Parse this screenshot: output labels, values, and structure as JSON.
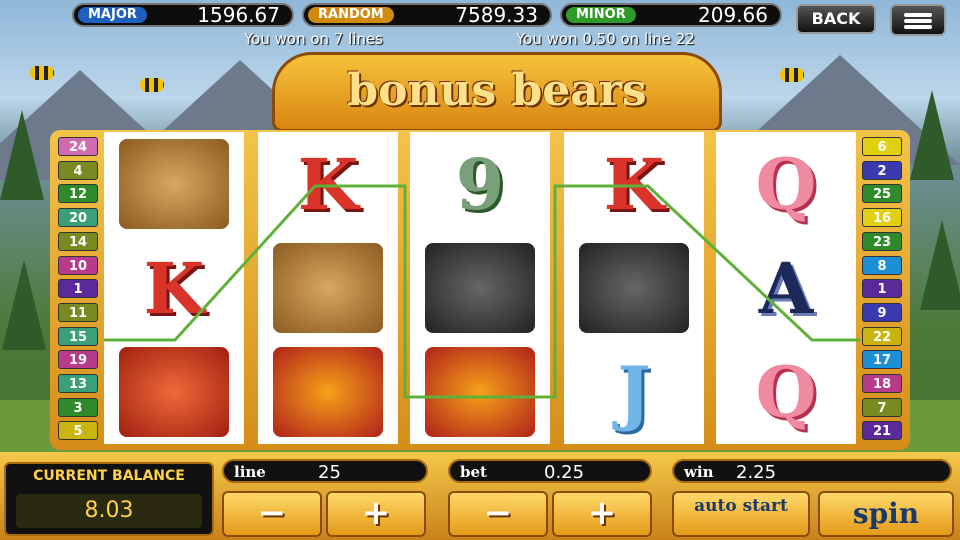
{
  "jackpots": [
    {
      "label": "MAJOR",
      "value": "1596.67",
      "color": "#1e5fc0"
    },
    {
      "label": "RANDOM",
      "value": "7589.33",
      "color": "#d08a10"
    },
    {
      "label": "MINOR",
      "value": "209.66",
      "color": "#2f9a2a"
    }
  ],
  "nav": {
    "back_label": "BACK"
  },
  "messages": {
    "left": "You won on 7 lines",
    "right": "You won 0.50 on line 22"
  },
  "title": "bonus bears",
  "reels": [
    {
      "symbols": [
        "picnic-basket",
        "K",
        "ranger-girl"
      ]
    },
    {
      "symbols": [
        "K",
        "picnic-basket",
        "bear"
      ]
    },
    {
      "symbols": [
        "9",
        "skunk",
        "bear"
      ]
    },
    {
      "symbols": [
        "K",
        "skunk",
        "J"
      ]
    },
    {
      "symbols": [
        "Q",
        "A",
        "Q"
      ]
    }
  ],
  "lines_left": [
    "24",
    "4",
    "12",
    "20",
    "14",
    "10",
    "1",
    "11",
    "15",
    "19",
    "13",
    "3",
    "5"
  ],
  "lines_right": [
    "6",
    "2",
    "25",
    "16",
    "23",
    "8",
    "1",
    "9",
    "22",
    "17",
    "18",
    "7",
    "21"
  ],
  "balance": {
    "label": "CURRENT BALANCE",
    "value": "8.03"
  },
  "line": {
    "label": "line",
    "value": "25"
  },
  "bet": {
    "label": "bet",
    "value": "0.25"
  },
  "win": {
    "label": "win",
    "value": "2.25"
  },
  "buttons": {
    "minus": "−",
    "plus": "+",
    "auto_start": "auto start",
    "spin": "spin"
  },
  "colors": {
    "winline": "#5fb13a"
  }
}
